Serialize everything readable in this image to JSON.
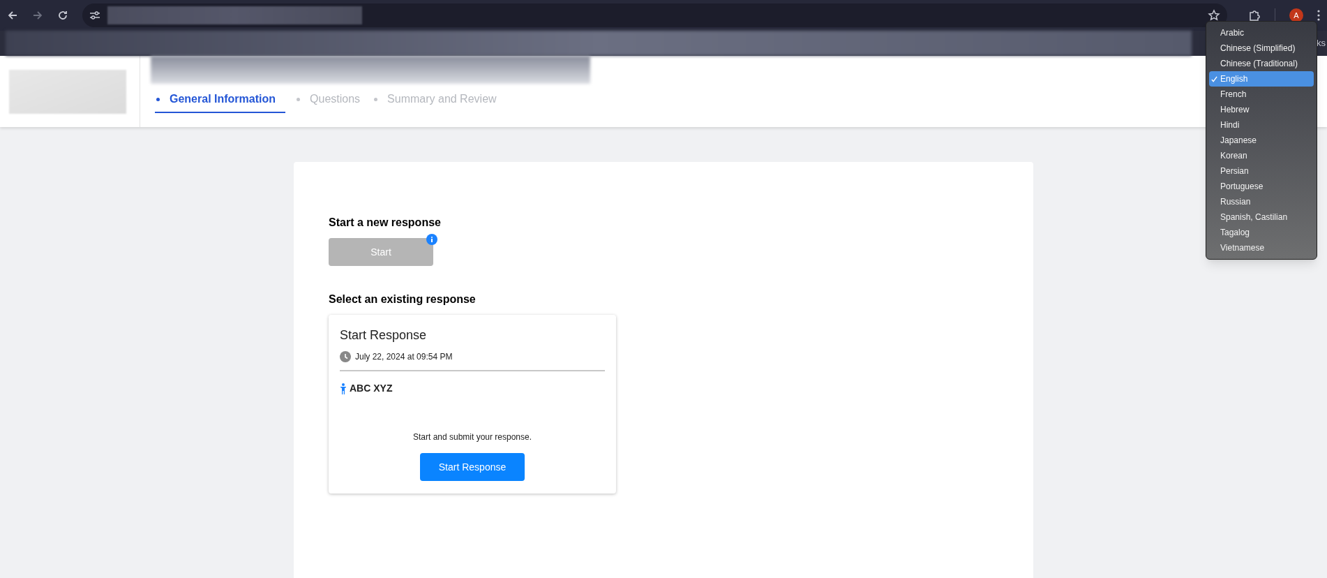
{
  "browser": {
    "avatar_letter": "A",
    "bookmarks_label_cut": "ks"
  },
  "steps": [
    {
      "label": "General Information",
      "selected": true
    },
    {
      "label": "Questions",
      "selected": false
    },
    {
      "label": "Summary and Review",
      "selected": false
    }
  ],
  "new_response": {
    "heading": "Start a new response",
    "button": {
      "label": "Start",
      "disabled": true
    }
  },
  "existing": {
    "heading": "Select an existing response",
    "cards": [
      {
        "title": "Start Response",
        "date": "July 22, 2024 at 09:54 PM",
        "person": "ABC XYZ",
        "message": "Start and submit your response.",
        "button": "Start Response"
      }
    ]
  },
  "language_menu": {
    "items": [
      {
        "label": "Arabic",
        "selected": false
      },
      {
        "label": "Chinese (Simplified)",
        "selected": false
      },
      {
        "label": "Chinese (Traditional)",
        "selected": false
      },
      {
        "label": "English",
        "selected": true
      },
      {
        "label": "French",
        "selected": false
      },
      {
        "label": "Hebrew",
        "selected": false
      },
      {
        "label": "Hindi",
        "selected": false
      },
      {
        "label": "Japanese",
        "selected": false
      },
      {
        "label": "Korean",
        "selected": false
      },
      {
        "label": "Persian",
        "selected": false
      },
      {
        "label": "Portuguese",
        "selected": false
      },
      {
        "label": "Russian",
        "selected": false
      },
      {
        "label": "Spanish, Castilian",
        "selected": false
      },
      {
        "label": "Tagalog",
        "selected": false
      },
      {
        "label": "Vietnamese",
        "selected": false
      }
    ]
  }
}
